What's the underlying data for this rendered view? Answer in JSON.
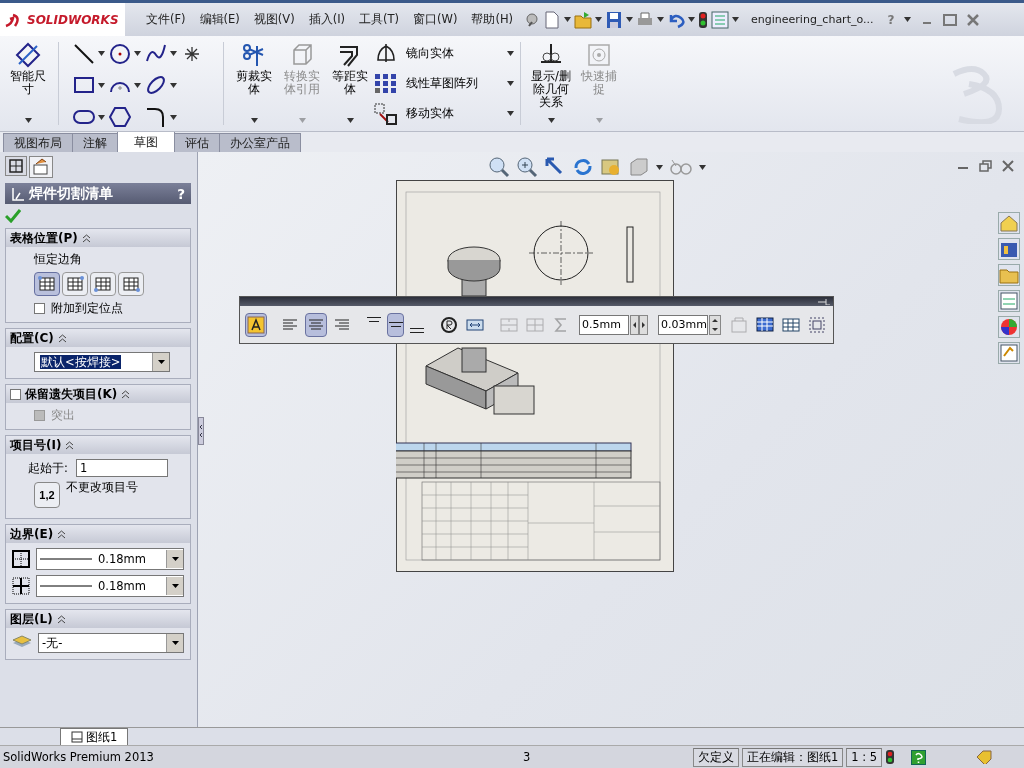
{
  "title_bar": {
    "logo": "SOLIDWORKS",
    "menus": [
      "文件(F)",
      "编辑(E)",
      "视图(V)",
      "插入(I)",
      "工具(T)",
      "窗口(W)",
      "帮助(H)"
    ],
    "document_title": "engineering_chart_o...",
    "help_label": "?"
  },
  "ribbon": {
    "tools": [
      {
        "kind": "smart-dimension",
        "label": "智能尺寸",
        "disabled": false
      },
      {
        "kind": "sketch-grid"
      },
      {
        "kind": "trim",
        "label": "剪裁实体",
        "disabled": false
      },
      {
        "kind": "convert",
        "label": "转换实体引用",
        "disabled": true
      },
      {
        "kind": "offset",
        "label": "等距实体",
        "disabled": false
      },
      {
        "kind": "list",
        "items": [
          {
            "kind": "mirror",
            "label": "镜向实体"
          },
          {
            "kind": "pattern",
            "label": "线性草图阵列"
          },
          {
            "kind": "move",
            "label": "移动实体"
          }
        ]
      },
      {
        "kind": "relations",
        "label": "显示/删除几何关系",
        "disabled": false
      },
      {
        "kind": "snap",
        "label": "快速捕捉",
        "disabled": true
      }
    ]
  },
  "command_tabs": [
    {
      "label": "视图布局",
      "selected": false
    },
    {
      "label": "注解",
      "selected": false
    },
    {
      "label": "草图",
      "selected": true
    },
    {
      "label": "评估",
      "selected": false
    },
    {
      "label": "办公室产品",
      "selected": false
    }
  ],
  "property_manager": {
    "title": "焊件切割清单",
    "help_label": "?",
    "sections": [
      {
        "kind": "position",
        "title": "表格位置(P)",
        "caption": "恒定边角",
        "anchors": [
          {
            "selected": true
          },
          {
            "selected": false
          },
          {
            "selected": false
          },
          {
            "selected": false
          }
        ],
        "option": {
          "label": "附加到定位点",
          "checked": false
        }
      },
      {
        "kind": "configuration",
        "title": "配置(C)",
        "value": "默认<按焊接>"
      },
      {
        "kind": "keep-missing",
        "title": "保留遗失项目(K)",
        "checked": false,
        "option": {
          "label": "突出",
          "checked": false,
          "disabled": true
        }
      },
      {
        "kind": "item-numbers",
        "title": "项目号(I)",
        "start_label": "起始于:",
        "start_value": "1",
        "button_label": "1,2",
        "button_caption": "不更改项目号"
      },
      {
        "kind": "border",
        "title": "边界(E)",
        "values": [
          "0.18mm",
          "0.18mm"
        ]
      },
      {
        "kind": "layer",
        "title": "图层(L)",
        "value": "-无-"
      }
    ]
  },
  "format_toolbar": {
    "buttons": [
      {
        "kind": "font",
        "selected": true,
        "disabled": false
      },
      {
        "kind": "align-left",
        "selected": false,
        "disabled": false
      },
      {
        "kind": "align-center",
        "selected": true,
        "disabled": false
      },
      {
        "kind": "align-right",
        "selected": false,
        "disabled": false
      },
      {
        "kind": "align-top",
        "selected": false,
        "disabled": false
      },
      {
        "kind": "align-middle",
        "selected": true,
        "disabled": false
      },
      {
        "kind": "align-bottom",
        "selected": false,
        "disabled": false
      },
      {
        "kind": "rotate",
        "selected": false,
        "disabled": false
      },
      {
        "kind": "fit",
        "selected": false,
        "disabled": false
      },
      {
        "kind": "merge",
        "selected": false,
        "disabled": true
      },
      {
        "kind": "split",
        "selected": false,
        "disabled": true
      },
      {
        "kind": "sum",
        "selected": false,
        "disabled": true
      }
    ],
    "fields": [
      "0.5mm",
      "0.03mm"
    ],
    "end_buttons": [
      {
        "kind": "properties",
        "disabled": true
      },
      {
        "kind": "table-blue",
        "disabled": false
      },
      {
        "kind": "table",
        "disabled": false
      },
      {
        "kind": "select",
        "disabled": false
      }
    ]
  },
  "sheet_tabs": [
    {
      "label": "图纸1",
      "selected": true
    }
  ],
  "status_bar": {
    "product": "SolidWorks Premium 2013",
    "value": "3",
    "sketch_state": "欠定义",
    "editing": "正在编辑：图纸1",
    "scale": "1 : 5"
  }
}
